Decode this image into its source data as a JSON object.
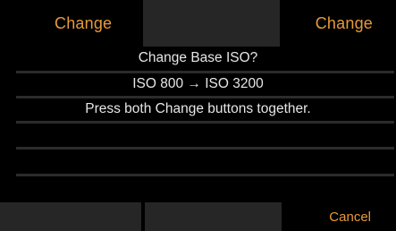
{
  "top_bar": {
    "left_label": "Change",
    "right_label": "Change"
  },
  "dialog": {
    "title": "Change Base ISO?",
    "change_text": "ISO 800 → ISO 3200",
    "instruction": "Press both Change buttons together."
  },
  "bottom_bar": {
    "cancel_label": "Cancel"
  },
  "colors": {
    "accent": "#e79a3a",
    "text": "#e6e6e6",
    "panel": "#262626",
    "divider": "#2b2b2b",
    "background": "#000000"
  }
}
